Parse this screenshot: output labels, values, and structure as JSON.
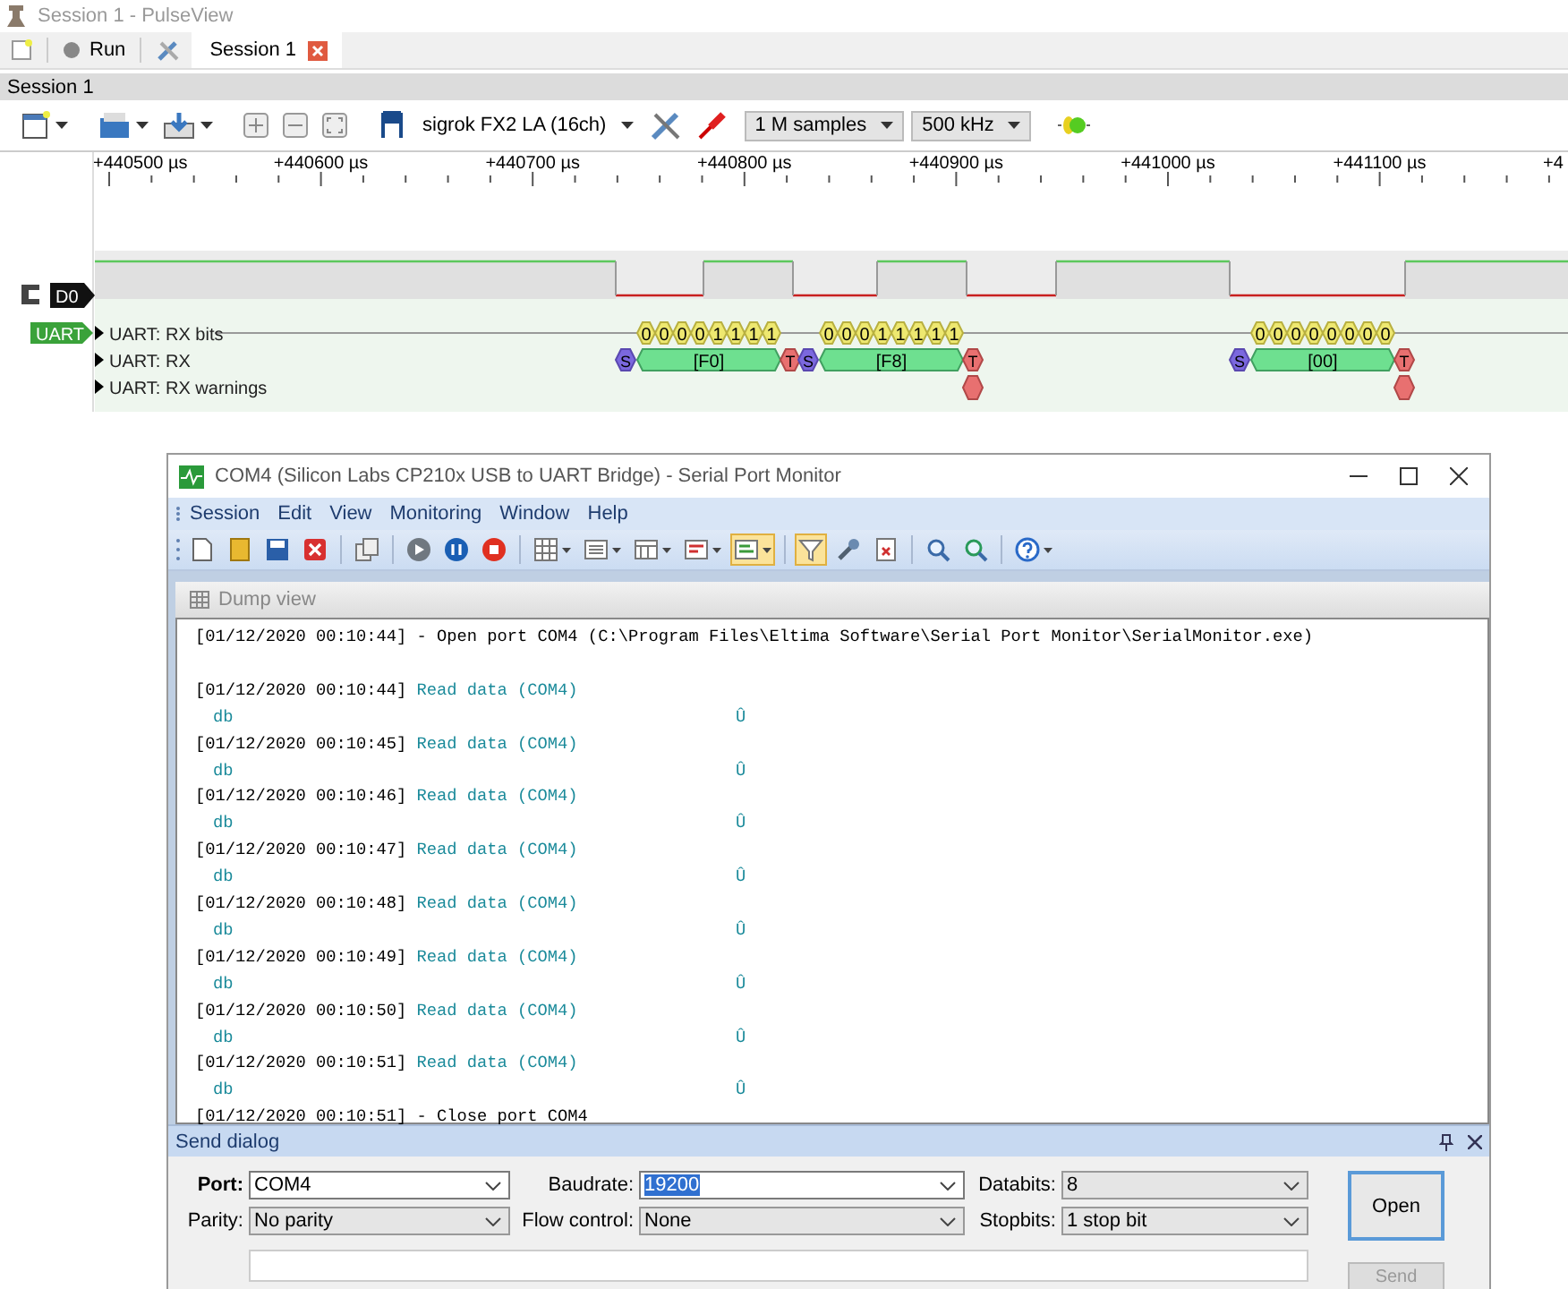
{
  "pulseview": {
    "title": "Session 1 - PulseView",
    "run_label": "Run",
    "tabs": [
      {
        "label": "Session 1",
        "selected": true
      }
    ],
    "session_header": "Session 1",
    "device": "sigrok FX2 LA (16ch)",
    "samples": "1 M samples",
    "samplerate": "500 kHz",
    "ruler": [
      "+440500 µs",
      "+440600 µs",
      "+440700 µs",
      "+440800 µs",
      "+440900 µs",
      "+441000 µs",
      "+441100 µs",
      "+4"
    ],
    "channel": {
      "label": "D0"
    },
    "decoder": {
      "label": "UART",
      "rows": [
        "UART: RX bits",
        "UART: RX",
        "UART: RX warnings"
      ],
      "frames": [
        {
          "bits": [
            "0",
            "0",
            "0",
            "0",
            "1",
            "1",
            "1",
            "1"
          ],
          "start": "S",
          "value": "[F0]",
          "stop": "T",
          "warning": false
        },
        {
          "bits": [
            "0",
            "0",
            "0",
            "1",
            "1",
            "1",
            "1",
            "1"
          ],
          "start": "S",
          "value": "[F8]",
          "stop": "T",
          "warning": true
        },
        {
          "bits": [
            "0",
            "0",
            "0",
            "0",
            "0",
            "0",
            "0",
            "0"
          ],
          "start": "S",
          "value": "[00]",
          "stop": "T",
          "warning": true
        }
      ]
    }
  },
  "serial_monitor": {
    "title": "COM4 (Silicon Labs CP210x USB to UART Bridge) - Serial Port Monitor",
    "menu": [
      "Session",
      "Edit",
      "View",
      "Monitoring",
      "Window",
      "Help"
    ],
    "toolbar": {
      "layout_toggle_on": true,
      "filter_on": true
    },
    "panel_title": "Dump view",
    "log": [
      {
        "kind": "event",
        "time": "[01/12/2020 00:10:44]",
        "text": "- Open port COM4 (C:\\Program Files\\Eltima Software\\Serial Port Monitor\\SerialMonitor.exe)"
      },
      {
        "kind": "read",
        "time": "[01/12/2020 00:10:44]",
        "text": "Read data (COM4)",
        "hex": "db",
        "char": "Û"
      },
      {
        "kind": "read",
        "time": "[01/12/2020 00:10:45]",
        "text": "Read data (COM4)",
        "hex": "db",
        "char": "Û"
      },
      {
        "kind": "read",
        "time": "[01/12/2020 00:10:46]",
        "text": "Read data (COM4)",
        "hex": "db",
        "char": "Û"
      },
      {
        "kind": "read",
        "time": "[01/12/2020 00:10:47]",
        "text": "Read data (COM4)",
        "hex": "db",
        "char": "Û"
      },
      {
        "kind": "read",
        "time": "[01/12/2020 00:10:48]",
        "text": "Read data (COM4)",
        "hex": "db",
        "char": "Û"
      },
      {
        "kind": "read",
        "time": "[01/12/2020 00:10:49]",
        "text": "Read data (COM4)",
        "hex": "db",
        "char": "Û"
      },
      {
        "kind": "read",
        "time": "[01/12/2020 00:10:50]",
        "text": "Read data (COM4)",
        "hex": "db",
        "char": "Û"
      },
      {
        "kind": "read",
        "time": "[01/12/2020 00:10:51]",
        "text": "Read data (COM4)",
        "hex": "db",
        "char": "Û"
      },
      {
        "kind": "event",
        "time": "[01/12/2020 00:10:51]",
        "text": "- Close port COM4"
      }
    ],
    "send_dialog": {
      "title": "Send dialog",
      "fields": [
        {
          "label": "Port:",
          "value": "COM4",
          "bold": true,
          "editable": true,
          "highlighted": false
        },
        {
          "label": "Baudrate:",
          "value": "19200",
          "bold": false,
          "editable": true,
          "highlighted": true
        },
        {
          "label": "Databits:",
          "value": "8",
          "bold": false,
          "editable": false,
          "highlighted": false
        },
        {
          "label": "Parity:",
          "value": "No parity",
          "bold": false,
          "editable": false,
          "highlighted": false
        },
        {
          "label": "Flow control:",
          "value": "None",
          "bold": false,
          "editable": false,
          "highlighted": false
        },
        {
          "label": "Stopbits:",
          "value": "1 stop bit",
          "bold": false,
          "editable": false,
          "highlighted": false
        }
      ],
      "open_button": "Open",
      "send_button": {
        "label": "Send",
        "disabled": true
      }
    }
  }
}
